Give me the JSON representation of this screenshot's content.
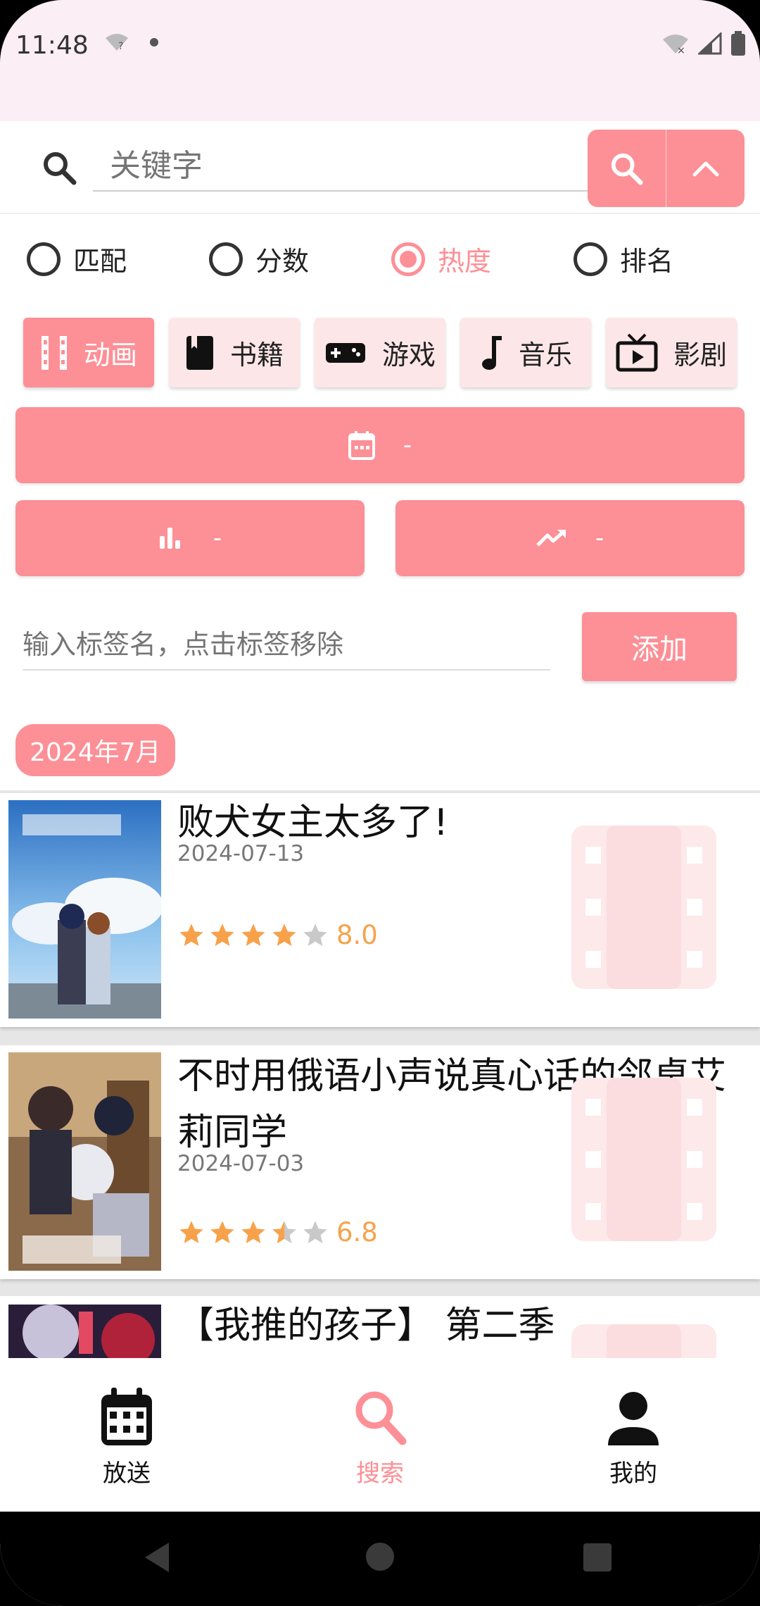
{
  "status": {
    "time": "11:48"
  },
  "search": {
    "placeholder": "关键字"
  },
  "sort_options": [
    {
      "label": "匹配",
      "selected": false
    },
    {
      "label": "分数",
      "selected": false
    },
    {
      "label": "热度",
      "selected": true
    },
    {
      "label": "排名",
      "selected": false
    }
  ],
  "categories": [
    {
      "label": "动画",
      "icon": "film-icon",
      "active": true
    },
    {
      "label": "书籍",
      "icon": "book-icon",
      "active": false
    },
    {
      "label": "游戏",
      "icon": "gamepad-icon",
      "active": false
    },
    {
      "label": "音乐",
      "icon": "music-note-icon",
      "active": false
    },
    {
      "label": "影剧",
      "icon": "tv-icon",
      "active": false
    }
  ],
  "filters": {
    "date_value": "-",
    "score_value": "-",
    "trend_value": "-"
  },
  "tag": {
    "placeholder": "输入标签名，点击标签移除",
    "add_label": "添加"
  },
  "month_label": "2024年7月",
  "items": [
    {
      "title": "败犬女主太多了!",
      "date": "2024-07-13",
      "rating": 8.0,
      "rating_text": "8.0",
      "stars": 4
    },
    {
      "title": "不时用俄语小声说真心话的邻桌艾莉同学",
      "date": "2024-07-03",
      "rating": 6.8,
      "rating_text": "6.8",
      "stars": 3.5
    },
    {
      "title": "【我推的孩子】 第二季",
      "date": "",
      "rating_text": "",
      "stars": 0
    }
  ],
  "bottom_nav": [
    {
      "label": "放送",
      "icon": "calendar-icon",
      "active": false
    },
    {
      "label": "搜索",
      "icon": "search-icon",
      "active": true
    },
    {
      "label": "我的",
      "icon": "person-icon",
      "active": false
    }
  ],
  "colors": {
    "accent": "#fd8f96",
    "accent_light": "#fde6e8",
    "star": "#f7a24b"
  }
}
